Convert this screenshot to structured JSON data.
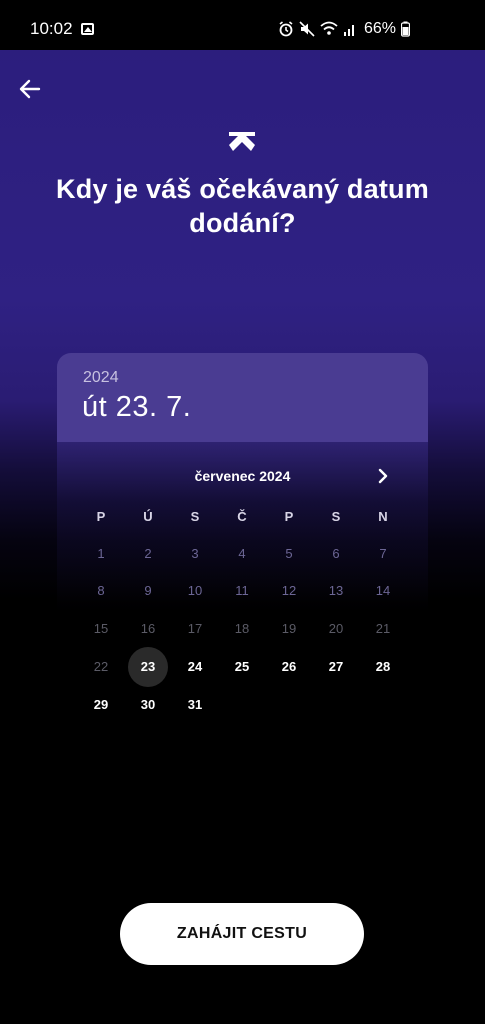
{
  "status_bar": {
    "time": "10:02",
    "battery": "66%",
    "icons": [
      "gallery-icon",
      "alarm-icon",
      "mute-icon",
      "wifi-icon",
      "signal-icon",
      "battery-icon"
    ]
  },
  "header": {
    "back_icon": "arrow-left-icon",
    "logo_icon": "app-logo-icon",
    "title": "Kdy je váš očekávaný datum dodání?"
  },
  "picker": {
    "year": "2024",
    "selected_date": "út 23. 7.",
    "month_label": "červenec 2024",
    "next_icon": "chevron-right-icon",
    "weekdays": [
      "P",
      "Ú",
      "S",
      "Č",
      "P",
      "S",
      "N"
    ],
    "weeks": [
      [
        "1",
        "2",
        "3",
        "4",
        "5",
        "6",
        "7"
      ],
      [
        "8",
        "9",
        "10",
        "11",
        "12",
        "13",
        "14"
      ],
      [
        "15",
        "16",
        "17",
        "18",
        "19",
        "20",
        "21"
      ],
      [
        "22",
        "23",
        "24",
        "25",
        "26",
        "27",
        "28"
      ],
      [
        "29",
        "30",
        "31"
      ]
    ],
    "selected_day": "23"
  },
  "cta": {
    "label": "ZAHÁJIT CESTU"
  },
  "colors": {
    "accent_purple": "#2f2183",
    "header_purple": "#4a3c92",
    "selected_day_bg": "#2a2a2a",
    "button_bg": "#ffffff"
  }
}
